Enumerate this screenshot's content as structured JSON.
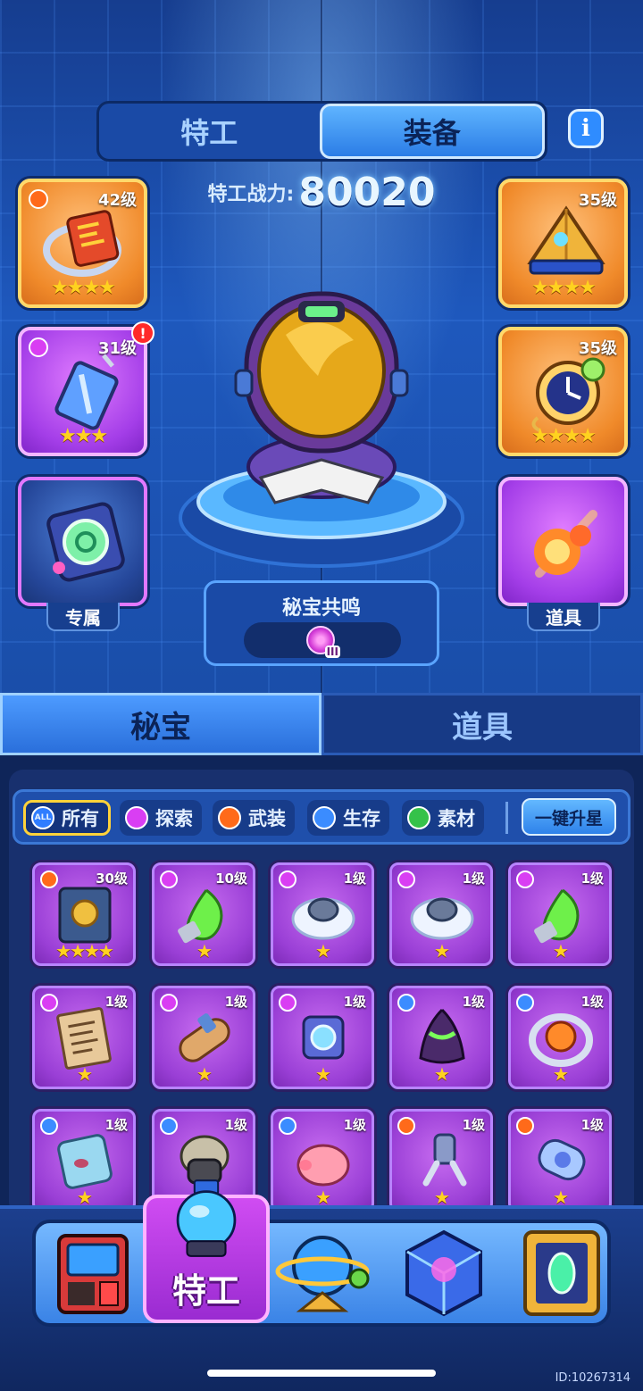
{
  "top_tabs": [
    {
      "label": "特工",
      "active": false
    },
    {
      "label": "装备",
      "active": true
    }
  ],
  "info_icon": "i",
  "power": {
    "label": "特工战力:",
    "value": "80020"
  },
  "equipment_slots": {
    "left": [
      {
        "level": "42级",
        "stars": "★★★★",
        "category": "crown-icon",
        "frame": "orange"
      },
      {
        "level": "31级",
        "stars": "★★★",
        "category": "gem-icon",
        "frame": "purple",
        "alert": "!"
      },
      {
        "caption": "专属",
        "frame": "blue"
      }
    ],
    "right": [
      {
        "level": "35级",
        "stars": "★★★★",
        "frame": "orange"
      },
      {
        "level": "35级",
        "stars": "★★★★",
        "frame": "orange"
      },
      {
        "caption": "道具",
        "frame": "purple"
      }
    ]
  },
  "resonance": {
    "title": "秘宝共鸣",
    "tier": "III"
  },
  "section_tabs": [
    {
      "label": "秘宝",
      "active": true
    },
    {
      "label": "道具",
      "active": false
    }
  ],
  "filters": [
    {
      "icon_text": "ALL",
      "label": "所有",
      "active": true
    },
    {
      "label": "探索",
      "active": false
    },
    {
      "label": "武装",
      "active": false
    },
    {
      "label": "生存",
      "active": false
    },
    {
      "label": "素材",
      "active": false
    }
  ],
  "upgrade_button": "一键升星",
  "items": [
    {
      "level": "30级",
      "stars": "★★★★",
      "badge": "crown",
      "icon": "rune-book-icon"
    },
    {
      "level": "10级",
      "stars": "★",
      "badge": "gem",
      "icon": "green-flame-icon"
    },
    {
      "level": "1级",
      "stars": "★",
      "badge": "gem",
      "icon": "fur-collar-icon"
    },
    {
      "level": "1级",
      "stars": "★",
      "badge": "gem",
      "icon": "fur-collar-icon"
    },
    {
      "level": "1级",
      "stars": "★",
      "badge": "gem",
      "icon": "green-flame-icon"
    },
    {
      "level": "1级",
      "stars": "★",
      "badge": "gem",
      "icon": "scroll-cipher-icon"
    },
    {
      "level": "1级",
      "stars": "★",
      "badge": "gem",
      "icon": "parchment-roll-icon"
    },
    {
      "level": "1级",
      "stars": "★",
      "badge": "gem",
      "icon": "crystal-cube-icon"
    },
    {
      "level": "1级",
      "stars": "★",
      "badge": "shield",
      "icon": "green-cloak-icon"
    },
    {
      "level": "1级",
      "stars": "★",
      "badge": "shield",
      "icon": "fire-ring-icon"
    },
    {
      "level": "1级",
      "stars": "★",
      "badge": "shield",
      "icon": "ice-block-icon"
    },
    {
      "level": "1级",
      "stars": "★",
      "badge": "shield",
      "icon": "gas-mask-icon"
    },
    {
      "level": "1级",
      "stars": "★",
      "badge": "shield",
      "icon": "piggy-bank-icon"
    },
    {
      "level": "1级",
      "stars": "★",
      "badge": "crown",
      "icon": "robot-arm-icon"
    },
    {
      "level": "1级",
      "stars": "★",
      "badge": "crown",
      "icon": "capsule-icon"
    }
  ],
  "bottom_nav": [
    {
      "label": "",
      "icon": "arcade-machine-icon"
    },
    {
      "label": "特工",
      "icon": "agent-helmet-icon",
      "active": true
    },
    {
      "label": "",
      "icon": "planet-icon"
    },
    {
      "label": "",
      "icon": "glowing-cube-icon"
    },
    {
      "label": "",
      "icon": "portal-frame-icon"
    }
  ],
  "user_id": "ID:10267314"
}
